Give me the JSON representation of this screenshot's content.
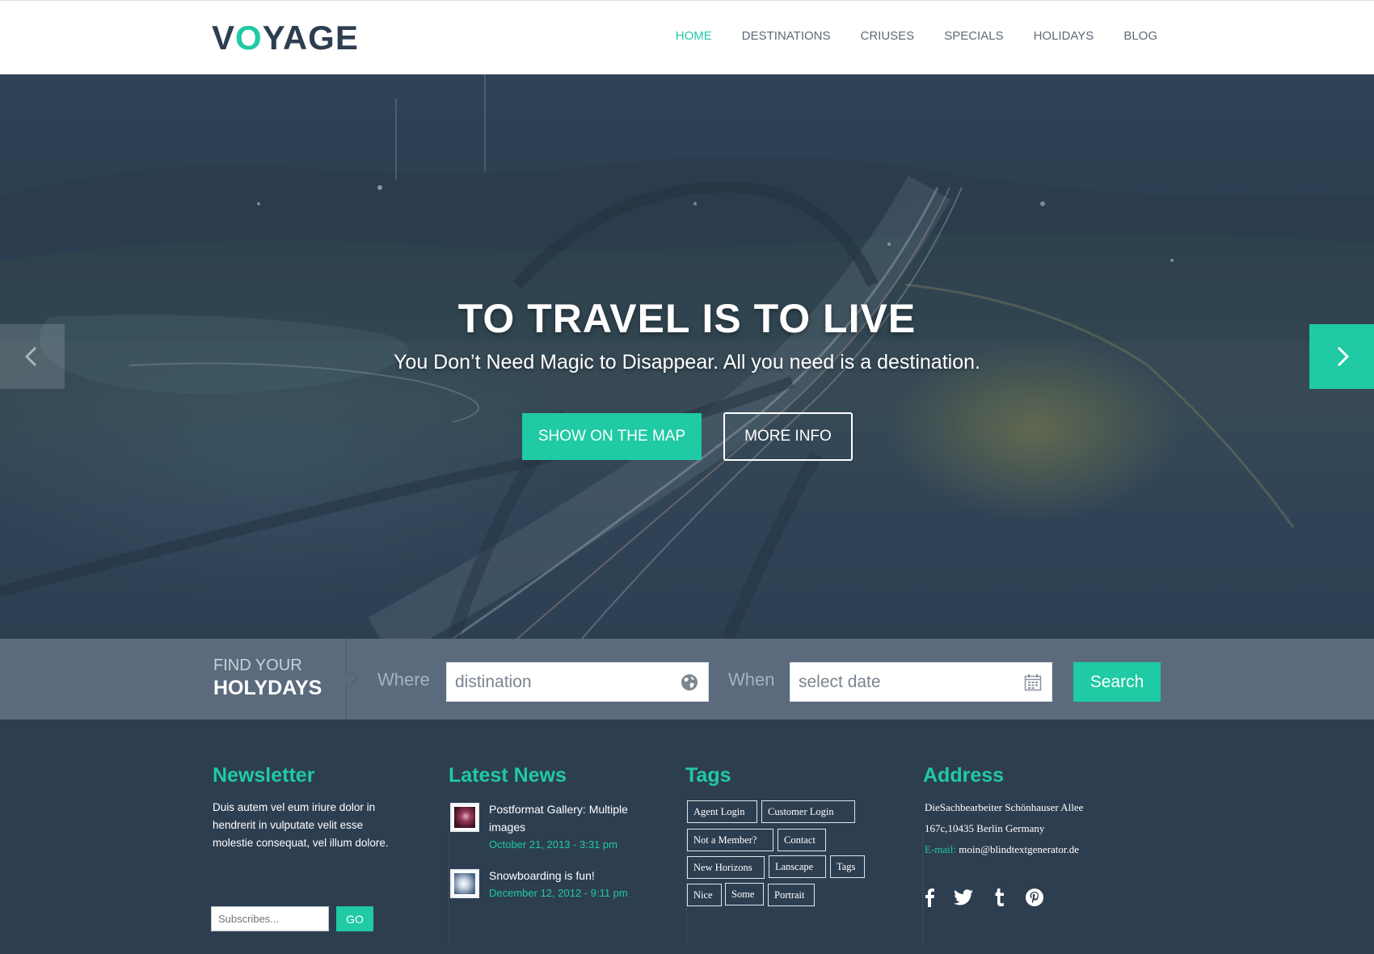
{
  "brand": {
    "logo_v": "V",
    "logo_o": "O",
    "logo_rest": "YAGE",
    "accent_color": "#1fcaa4",
    "dark_color": "#2e3e51"
  },
  "nav": {
    "items": [
      {
        "label": "HOME",
        "active": true
      },
      {
        "label": "DESTINATIONS",
        "active": false
      },
      {
        "label": "CRIUSES",
        "active": false
      },
      {
        "label": "SPECIALS",
        "active": false
      },
      {
        "label": "HOLIDAYS",
        "active": false
      },
      {
        "label": "BLOG",
        "active": false
      }
    ]
  },
  "hero": {
    "title": "TO TRAVEL IS TO LIVE",
    "subtitle": "You Don’t Need Magic to Disappear. All you need is a destination.",
    "primary_button": "SHOW ON THE MAP",
    "secondary_button": "MORE INFO",
    "prev_icon": "chevron-left-icon",
    "next_icon": "chevron-right-icon"
  },
  "search": {
    "heading_line1": "FIND YOUR",
    "heading_line2": "HOLYDAYS",
    "where_label": "Where",
    "where_placeholder": "distination",
    "where_icon": "globe-icon",
    "when_label": "When",
    "when_placeholder": "select date",
    "when_icon": "calendar-icon",
    "button": "Search"
  },
  "footer": {
    "newsletter": {
      "title": "Newsletter",
      "text": "Duis autem vel eum iriure dolor in hendrerit in vulputate velit esse molestie consequat, vel illum dolore.",
      "input_placeholder": "Subscribes...",
      "button": "GO"
    },
    "news": {
      "title": "Latest News",
      "items": [
        {
          "title": "Postformat Gallery: Multiple images",
          "date": "October 21, 2013 - 3:31 pm"
        },
        {
          "title": "Snowboarding is fun!",
          "date": "December 12, 2012 - 9:11 pm"
        }
      ]
    },
    "tags": {
      "title": "Tags",
      "items": [
        "Agent Login",
        "Customer Login",
        "Not a Member?",
        "Contact",
        "New Horizons",
        "Lanscape",
        "Tags",
        "Nice",
        "Some",
        "Portrait"
      ]
    },
    "address": {
      "title": "Address",
      "line1": "DieSachbearbeiter Schönhauser Allee",
      "line2": "167c,10435 Berlin Germany",
      "email_label": "E-mail:",
      "email": "moin@blindtextgenerator.de",
      "social_icons": [
        "facebook-icon",
        "twitter-icon",
        "tumblr-icon",
        "pinterest-icon"
      ]
    }
  }
}
